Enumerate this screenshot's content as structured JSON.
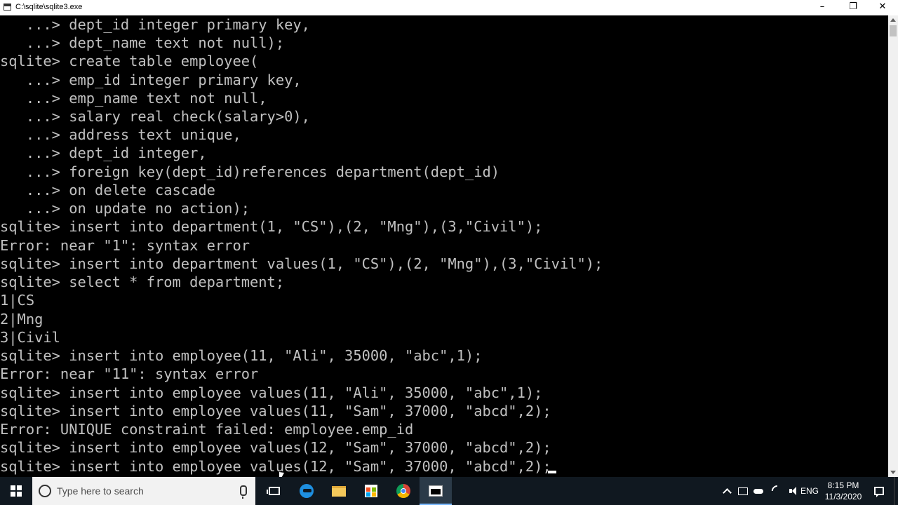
{
  "window": {
    "title": "C:\\sqlite\\sqlite3.exe",
    "buttons": {
      "minimize": "–",
      "maximize": "❐",
      "close": "✕"
    }
  },
  "console": {
    "lines": [
      "   ...> dept_id integer primary key,",
      "   ...> dept_name text not null);",
      "sqlite> create table employee(",
      "   ...> emp_id integer primary key,",
      "   ...> emp_name text not null,",
      "   ...> salary real check(salary>0),",
      "   ...> address text unique,",
      "   ...> dept_id integer,",
      "   ...> foreign key(dept_id)references department(dept_id)",
      "   ...> on delete cascade",
      "   ...> on update no action);",
      "sqlite> insert into department(1, \"CS\"),(2, \"Mng\"),(3,\"Civil\");",
      "Error: near \"1\": syntax error",
      "sqlite> insert into department values(1, \"CS\"),(2, \"Mng\"),(3,\"Civil\");",
      "sqlite> select * from department;",
      "1|CS",
      "2|Mng",
      "3|Civil",
      "sqlite> insert into employee(11, \"Ali\", 35000, \"abc\",1);",
      "Error: near \"11\": syntax error",
      "sqlite> insert into employee values(11, \"Ali\", 35000, \"abc\",1);",
      "sqlite> insert into employee values(11, \"Sam\", 37000, \"abcd\",2);",
      "Error: UNIQUE constraint failed: employee.emp_id",
      "sqlite> insert into employee values(12, \"Sam\", 37000, \"abcd\",2);",
      "sqlite> insert into employee values(12, \"Sam\", 37000, \"abcd\",2);"
    ]
  },
  "taskbar": {
    "search_placeholder": "Type here to search",
    "apps": [
      "edge-icon",
      "file-explorer-icon",
      "store-icon",
      "chrome-icon",
      "sqlite-console-icon"
    ],
    "language": "ENG",
    "time": "8:15 PM",
    "date": "11/3/2020"
  },
  "colors": {
    "console_bg": "#000000",
    "console_text": "#c0c0c0",
    "taskbar_bg": "#101820"
  }
}
